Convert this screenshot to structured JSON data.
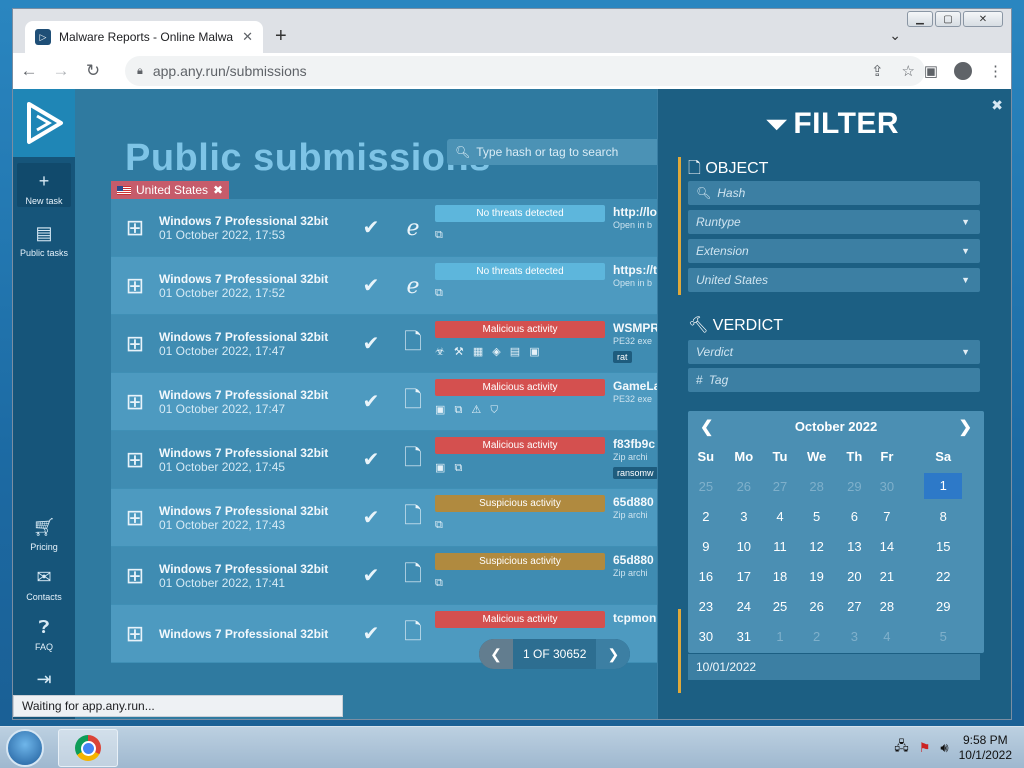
{
  "browser": {
    "tab_title": "Malware Reports - Online Malwa",
    "url": "app.any.run/submissions"
  },
  "sidebar": {
    "new_task": "New task",
    "public_tasks": "Public tasks",
    "pricing": "Pricing",
    "contacts": "Contacts",
    "faq": "FAQ"
  },
  "main": {
    "title": "Public submissions",
    "search_placeholder": "Type hash or tag to search",
    "chip": "United States",
    "pager": "1 OF 30652"
  },
  "rows": [
    {
      "os": "Windows 7 Professional 32bit",
      "date": "01 October 2022, 17:53",
      "verdict": "No threats detected",
      "vclass": "ok",
      "tags": "⧉",
      "target": "http://lo",
      "sub": "Open in b",
      "mini": ""
    },
    {
      "os": "Windows 7 Professional 32bit",
      "date": "01 October 2022, 17:52",
      "verdict": "No threats detected",
      "vclass": "ok",
      "tags": "⧉",
      "target": "https://t",
      "sub": "Open in b",
      "mini": ""
    },
    {
      "os": "Windows 7 Professional 32bit",
      "date": "01 October 2022, 17:47",
      "verdict": "Malicious activity",
      "vclass": "bad",
      "tags": "☣ ⚒ ▦ ◈ ▤ ▣",
      "target": "WSMPR",
      "sub": "PE32 exe",
      "mini": "rat"
    },
    {
      "os": "Windows 7 Professional 32bit",
      "date": "01 October 2022, 17:47",
      "verdict": "Malicious activity",
      "vclass": "bad",
      "tags": "▣ ⧉ ⚠ ⛉",
      "target": "GameLa",
      "sub": "PE32 exe",
      "mini": ""
    },
    {
      "os": "Windows 7 Professional 32bit",
      "date": "01 October 2022, 17:45",
      "verdict": "Malicious activity",
      "vclass": "bad",
      "tags": "▣ ⧉",
      "target": "f83fb9c",
      "sub": "Zip archi",
      "mini": "ransomw"
    },
    {
      "os": "Windows 7 Professional 32bit",
      "date": "01 October 2022, 17:43",
      "verdict": "Suspicious activity",
      "vclass": "sus",
      "tags": "⧉",
      "target": "65d880",
      "sub": "Zip archi",
      "mini": ""
    },
    {
      "os": "Windows 7 Professional 32bit",
      "date": "01 October 2022, 17:41",
      "verdict": "Suspicious activity",
      "vclass": "sus",
      "tags": "⧉",
      "target": "65d880",
      "sub": "Zip archi",
      "mini": ""
    },
    {
      "os": "Windows 7 Professional 32bit",
      "date": "",
      "verdict": "Malicious activity",
      "vclass": "bad",
      "tags": "",
      "target": "tcpmon.",
      "sub": "",
      "mini": ""
    }
  ],
  "filter": {
    "title": "FILTER",
    "object_title": "OBJECT",
    "hash": "Hash",
    "runtype": "Runtype",
    "extension": "Extension",
    "country": "United States",
    "verdict_title": "VERDICT",
    "verdict": "Verdict",
    "tag": "Tag",
    "date_value": "10/01/2022"
  },
  "calendar": {
    "month": "October 2022",
    "days": [
      "Su",
      "Mo",
      "Tu",
      "We",
      "Th",
      "Fr",
      "Sa"
    ],
    "weeks": [
      [
        {
          "d": "25",
          "m": 1
        },
        {
          "d": "26",
          "m": 1
        },
        {
          "d": "27",
          "m": 1
        },
        {
          "d": "28",
          "m": 1
        },
        {
          "d": "29",
          "m": 1
        },
        {
          "d": "30",
          "m": 1
        },
        {
          "d": "1",
          "s": 1
        }
      ],
      [
        {
          "d": "2"
        },
        {
          "d": "3"
        },
        {
          "d": "4"
        },
        {
          "d": "5"
        },
        {
          "d": "6"
        },
        {
          "d": "7"
        },
        {
          "d": "8"
        }
      ],
      [
        {
          "d": "9"
        },
        {
          "d": "10"
        },
        {
          "d": "11"
        },
        {
          "d": "12"
        },
        {
          "d": "13"
        },
        {
          "d": "14"
        },
        {
          "d": "15"
        }
      ],
      [
        {
          "d": "16"
        },
        {
          "d": "17"
        },
        {
          "d": "18"
        },
        {
          "d": "19"
        },
        {
          "d": "20"
        },
        {
          "d": "21"
        },
        {
          "d": "22"
        }
      ],
      [
        {
          "d": "23"
        },
        {
          "d": "24"
        },
        {
          "d": "25"
        },
        {
          "d": "26"
        },
        {
          "d": "27"
        },
        {
          "d": "28"
        },
        {
          "d": "29"
        }
      ],
      [
        {
          "d": "30"
        },
        {
          "d": "31"
        },
        {
          "d": "1",
          "m": 1
        },
        {
          "d": "2",
          "m": 1
        },
        {
          "d": "3",
          "m": 1
        },
        {
          "d": "4",
          "m": 1
        },
        {
          "d": "5",
          "m": 1
        }
      ]
    ]
  },
  "status": "Waiting for app.any.run...",
  "clock": {
    "time": "9:58 PM",
    "date": "10/1/2022"
  }
}
